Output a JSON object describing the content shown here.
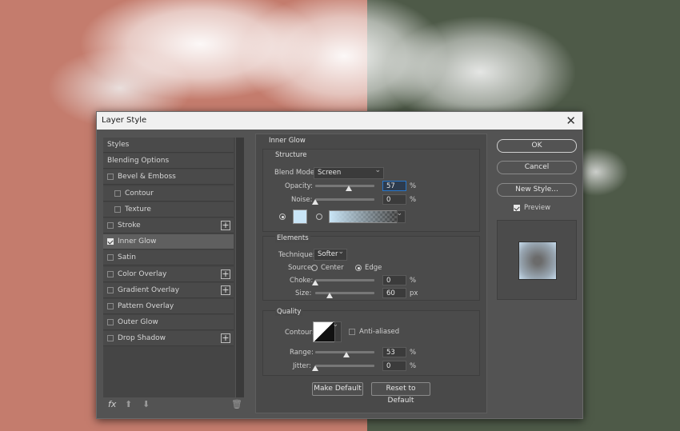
{
  "window": {
    "title": "Layer Style",
    "close_icon": "close-icon"
  },
  "styles_list": {
    "items": [
      {
        "label": "Styles",
        "checkbox": false,
        "checked": false,
        "plus": false,
        "indent": false,
        "selected": false
      },
      {
        "label": "Blending Options",
        "checkbox": false,
        "checked": false,
        "plus": false,
        "indent": false,
        "selected": false
      },
      {
        "label": "Bevel & Emboss",
        "checkbox": true,
        "checked": false,
        "plus": false,
        "indent": false,
        "selected": false
      },
      {
        "label": "Contour",
        "checkbox": true,
        "checked": false,
        "plus": false,
        "indent": true,
        "selected": false
      },
      {
        "label": "Texture",
        "checkbox": true,
        "checked": false,
        "plus": false,
        "indent": true,
        "selected": false
      },
      {
        "label": "Stroke",
        "checkbox": true,
        "checked": false,
        "plus": true,
        "indent": false,
        "selected": false
      },
      {
        "label": "Inner Glow",
        "checkbox": true,
        "checked": true,
        "plus": false,
        "indent": false,
        "selected": true
      },
      {
        "label": "Satin",
        "checkbox": true,
        "checked": false,
        "plus": false,
        "indent": false,
        "selected": false
      },
      {
        "label": "Color Overlay",
        "checkbox": true,
        "checked": false,
        "plus": true,
        "indent": false,
        "selected": false
      },
      {
        "label": "Gradient Overlay",
        "checkbox": true,
        "checked": false,
        "plus": true,
        "indent": false,
        "selected": false
      },
      {
        "label": "Pattern Overlay",
        "checkbox": true,
        "checked": false,
        "plus": false,
        "indent": false,
        "selected": false
      },
      {
        "label": "Outer Glow",
        "checkbox": true,
        "checked": false,
        "plus": false,
        "indent": false,
        "selected": false
      },
      {
        "label": "Drop Shadow",
        "checkbox": true,
        "checked": false,
        "plus": true,
        "indent": false,
        "selected": false
      }
    ],
    "fx_label": "fx"
  },
  "inner_glow": {
    "title": "Inner Glow",
    "structure": {
      "title": "Structure",
      "blend_mode_label": "Blend Mode:",
      "blend_mode_value": "Screen",
      "opacity_label": "Opacity:",
      "opacity_value": "57",
      "opacity_unit": "%",
      "noise_label": "Noise:",
      "noise_value": "0",
      "noise_unit": "%",
      "color_mode_selected": "solid",
      "glow_color": "#c9e5f6"
    },
    "elements": {
      "title": "Elements",
      "technique_label": "Technique:",
      "technique_value": "Softer",
      "source_label": "Source:",
      "source_center": "Center",
      "source_edge": "Edge",
      "source_selected": "Edge",
      "choke_label": "Choke:",
      "choke_value": "0",
      "choke_unit": "%",
      "size_label": "Size:",
      "size_value": "60",
      "size_unit": "px"
    },
    "quality": {
      "title": "Quality",
      "contour_label": "Contour:",
      "anti_aliased_label": "Anti-aliased",
      "anti_aliased_checked": false,
      "range_label": "Range:",
      "range_value": "53",
      "range_unit": "%",
      "jitter_label": "Jitter:",
      "jitter_value": "0",
      "jitter_unit": "%"
    },
    "make_default_label": "Make Default",
    "reset_default_label": "Reset to Default"
  },
  "actions": {
    "ok_label": "OK",
    "cancel_label": "Cancel",
    "new_style_label": "New Style...",
    "preview_label": "Preview",
    "preview_checked": true
  },
  "slider_fractions": {
    "opacity": 0.57,
    "noise": 0.0,
    "choke": 0.0,
    "size": 0.24,
    "range": 0.53,
    "jitter": 0.0
  }
}
